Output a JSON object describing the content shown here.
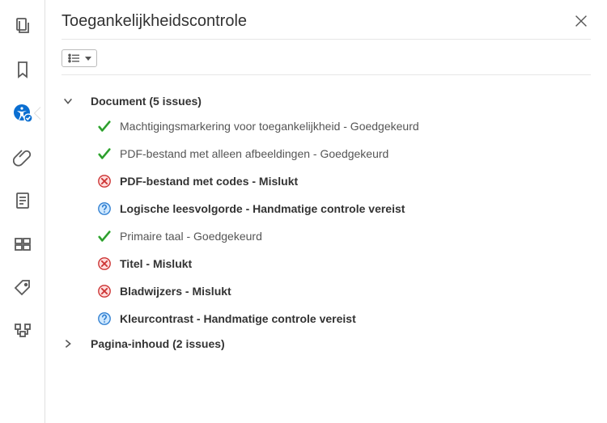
{
  "panel": {
    "title": "Toegankelijkheidscontrole"
  },
  "sidebar": {
    "items": [
      {
        "name": "pages"
      },
      {
        "name": "bookmarks"
      },
      {
        "name": "accessibility",
        "active": true
      },
      {
        "name": "attachments"
      },
      {
        "name": "document"
      },
      {
        "name": "edit"
      },
      {
        "name": "tags"
      },
      {
        "name": "order"
      }
    ]
  },
  "sections": [
    {
      "label": "Document (5 issues)",
      "expanded": true,
      "rules": [
        {
          "status": "pass",
          "label": "Machtigingsmarkering voor toegankelijkheid - Goedgekeurd",
          "bold": false
        },
        {
          "status": "pass",
          "label": "PDF-bestand met alleen afbeeldingen - Goedgekeurd",
          "bold": false
        },
        {
          "status": "fail",
          "label": "PDF-bestand met codes - Mislukt",
          "bold": true
        },
        {
          "status": "manual",
          "label": "Logische leesvolgorde - Handmatige controle vereist",
          "bold": true
        },
        {
          "status": "pass",
          "label": "Primaire taal - Goedgekeurd",
          "bold": false
        },
        {
          "status": "fail",
          "label": "Titel - Mislukt",
          "bold": true
        },
        {
          "status": "fail",
          "label": "Bladwijzers - Mislukt",
          "bold": true
        },
        {
          "status": "manual",
          "label": "Kleurcontrast - Handmatige controle vereist",
          "bold": true
        }
      ]
    },
    {
      "label": "Pagina-inhoud (2 issues)",
      "expanded": false,
      "rules": []
    }
  ]
}
